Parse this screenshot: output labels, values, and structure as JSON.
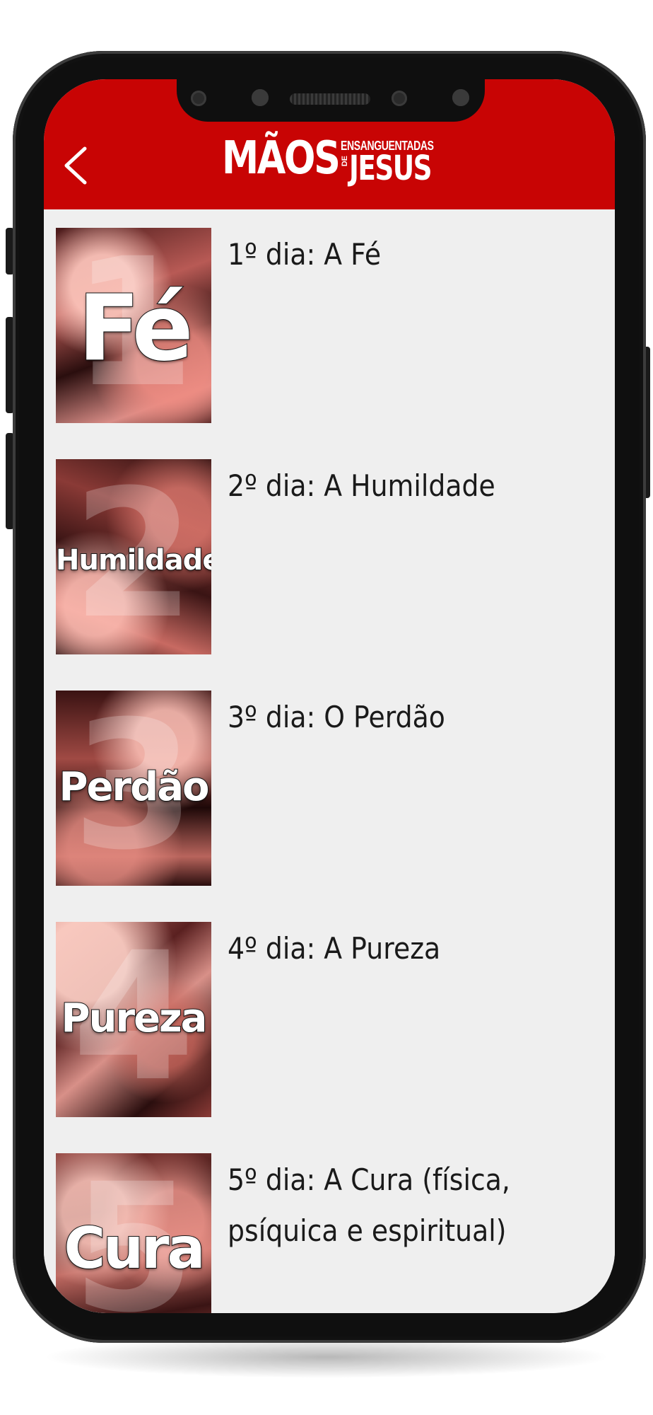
{
  "header": {
    "back_icon": "chevron-left-icon",
    "logo": {
      "line1": "MÃOS",
      "line2_small": "ENSANGUENTADAS",
      "line2_de": "DE",
      "line2_big": "JESUS"
    }
  },
  "colors": {
    "header_bg": "#c80404",
    "list_bg": "#efefef",
    "text": "#1a1a1a"
  },
  "days": [
    {
      "title": "1º dia: A Fé",
      "thumb_word": "Fé",
      "thumb_number": "1"
    },
    {
      "title": "2º dia: A Humildade",
      "thumb_word": "Humildade",
      "thumb_number": "2"
    },
    {
      "title": "3º dia: O Perdão",
      "thumb_word": "Perdão",
      "thumb_number": "3"
    },
    {
      "title": "4º dia: A Pureza",
      "thumb_word": "Pureza",
      "thumb_number": "4"
    },
    {
      "title": "5º dia: A Cura (física, psíquica e espiritual)",
      "thumb_word": "Cura",
      "thumb_number": "5"
    }
  ]
}
